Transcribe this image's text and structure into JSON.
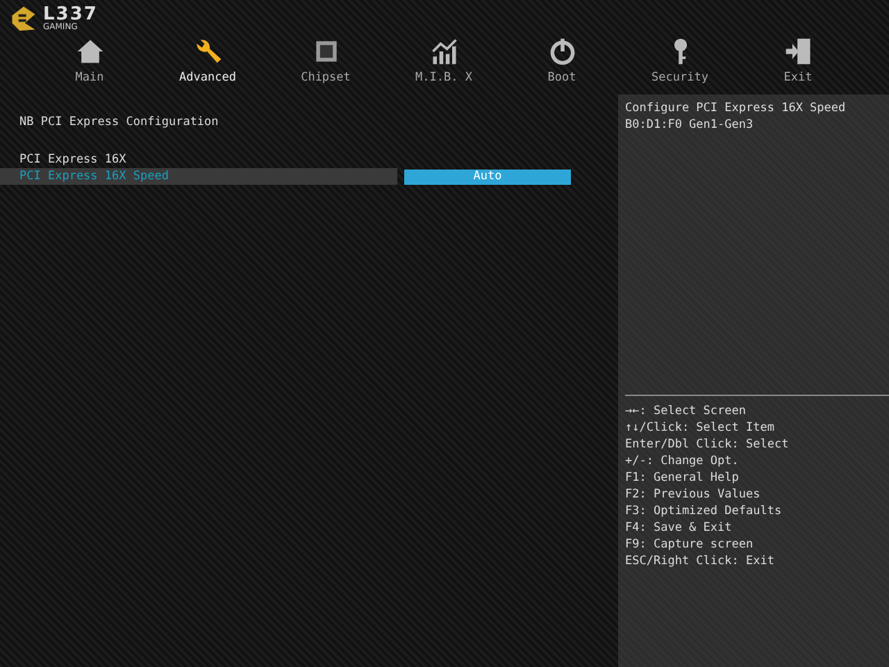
{
  "logo": {
    "name": "L337",
    "sub": "GAMING"
  },
  "tabs": [
    {
      "label": "Main",
      "kind": "home",
      "selected": false
    },
    {
      "label": "Advanced",
      "kind": "wrench",
      "selected": true
    },
    {
      "label": "Chipset",
      "kind": "chip",
      "selected": false
    },
    {
      "label": "M.I.B. X",
      "kind": "chart",
      "selected": false
    },
    {
      "label": "Boot",
      "kind": "power",
      "selected": false
    },
    {
      "label": "Security",
      "kind": "key",
      "selected": false
    },
    {
      "label": "Exit",
      "kind": "exit",
      "selected": false
    }
  ],
  "section_title": "NB PCI Express Configuration",
  "items": [
    {
      "kind": "text",
      "label": "PCI Express 16X",
      "selected": false
    },
    {
      "kind": "option",
      "label": "PCI Express 16X Speed",
      "value": "Auto",
      "selected": true
    }
  ],
  "help": [
    "Configure PCI Express 16X Speed",
    "B0:D1:F0 Gen1-Gen3"
  ],
  "key_hints": [
    "→←: Select Screen",
    "↑↓/Click: Select Item",
    "Enter/Dbl Click: Select",
    "+/-: Change Opt.",
    "F1: General Help",
    "F2: Previous Values",
    "F3: Optimized Defaults",
    "F4: Save & Exit",
    "F9: Capture screen",
    "ESC/Right Click: Exit"
  ]
}
